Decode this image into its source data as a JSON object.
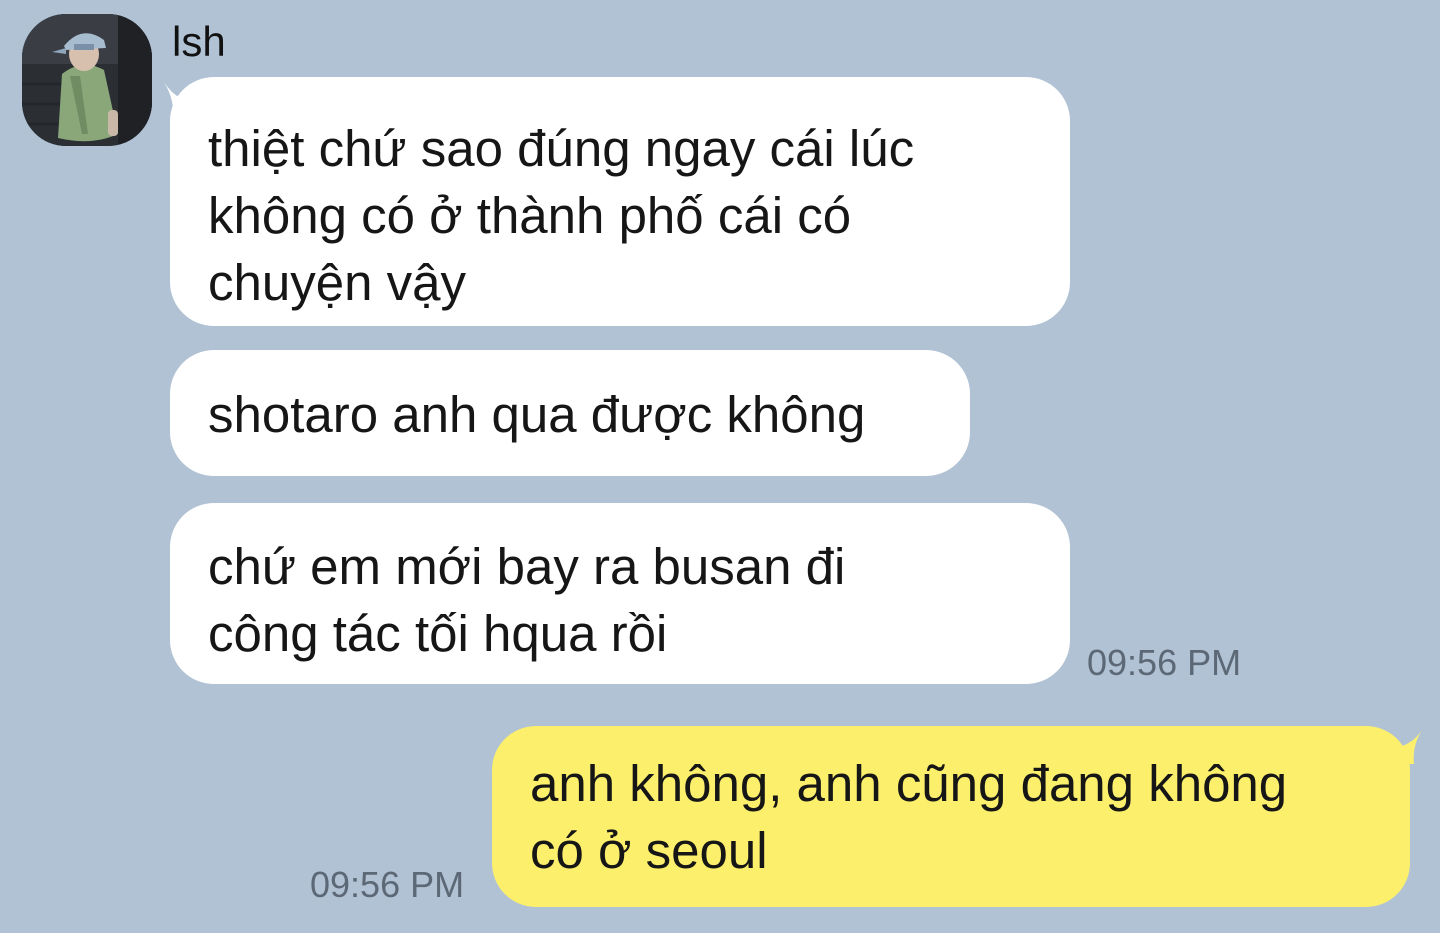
{
  "chat": {
    "sender_name": "lsh",
    "messages": [
      {
        "direction": "incoming",
        "lines": [
          "thiệt chứ sao đúng ngay cái lúc",
          "không có ở thành phố cái có",
          "chuyện vậy"
        ]
      },
      {
        "direction": "incoming",
        "lines": [
          "shotaro anh qua được không"
        ]
      },
      {
        "direction": "incoming",
        "lines": [
          "chứ em mới bay ra busan đi",
          "công tác tối hqua rồi"
        ],
        "time": "09:56 PM"
      },
      {
        "direction": "outgoing",
        "lines": [
          "anh không, anh cũng đang không",
          "có ở seoul"
        ],
        "time": "09:56 PM"
      }
    ]
  },
  "colors": {
    "background": "#b1c2d4",
    "incoming_bubble": "#ffffff",
    "outgoing_bubble": "#fbef6c",
    "timestamp": "#5c6875"
  },
  "icons": {
    "avatar": "profile-photo"
  }
}
